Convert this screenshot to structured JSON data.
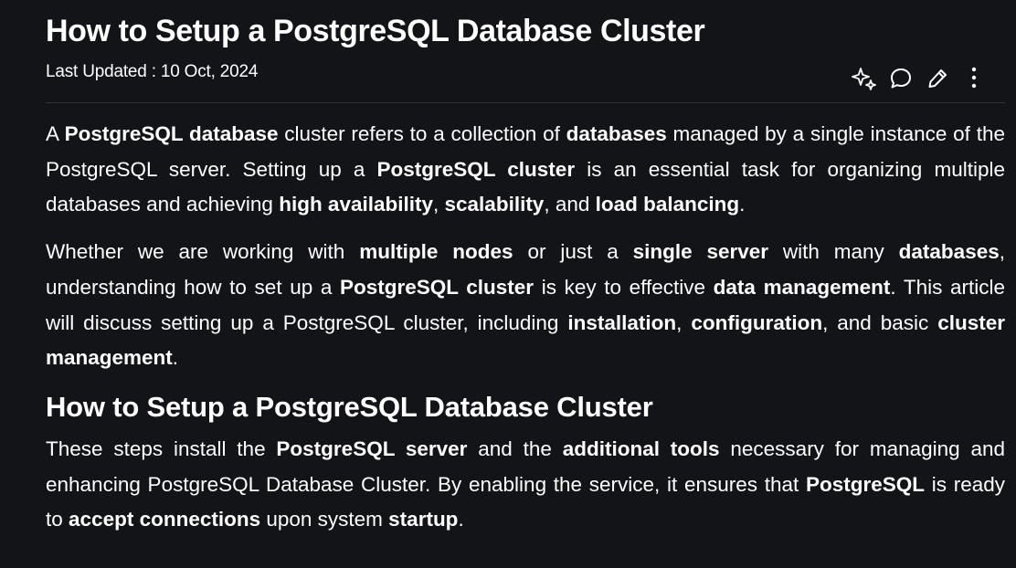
{
  "article": {
    "title": "How to Setup a PostgreSQL Database Cluster",
    "last_updated": "Last Updated : 10 Oct, 2024"
  },
  "actions": {
    "ai_icon": "sparkles-icon",
    "comment_icon": "comment-icon",
    "edit_icon": "pencil-icon",
    "more_icon": "more-vertical-icon"
  },
  "paragraphs": {
    "p1": [
      {
        "t": "A "
      },
      {
        "t": "PostgreSQL database",
        "b": true
      },
      {
        "t": " cluster refers to a collection of "
      },
      {
        "t": "databases",
        "b": true
      },
      {
        "t": " managed by a single instance of the PostgreSQL server. Setting up a "
      },
      {
        "t": "PostgreSQL cluster",
        "b": true
      },
      {
        "t": " is an essential task for organizing multiple databases and achieving "
      },
      {
        "t": "high availability",
        "b": true
      },
      {
        "t": ", "
      },
      {
        "t": "scalability",
        "b": true
      },
      {
        "t": ", and "
      },
      {
        "t": "load balancing",
        "b": true
      },
      {
        "t": "."
      }
    ],
    "p2": [
      {
        "t": "Whether we are working with "
      },
      {
        "t": "multiple nodes",
        "b": true
      },
      {
        "t": " or just a "
      },
      {
        "t": "single server",
        "b": true
      },
      {
        "t": " with many "
      },
      {
        "t": "databases",
        "b": true
      },
      {
        "t": ", understanding how to set up a "
      },
      {
        "t": "PostgreSQL cluster",
        "b": true
      },
      {
        "t": " is key to effective "
      },
      {
        "t": "data management",
        "b": true
      },
      {
        "t": ". This article will discuss setting up a PostgreSQL cluster, including "
      },
      {
        "t": "installation",
        "b": true
      },
      {
        "t": ", "
      },
      {
        "t": "configuration",
        "b": true
      },
      {
        "t": ", and basic "
      },
      {
        "t": "cluster management",
        "b": true
      },
      {
        "t": "."
      }
    ],
    "p3": [
      {
        "t": "These steps install the "
      },
      {
        "t": "PostgreSQL server",
        "b": true
      },
      {
        "t": " and the "
      },
      {
        "t": "additional tools",
        "b": true
      },
      {
        "t": " necessary for managing and enhancing PostgreSQL Database Cluster. By enabling the service, it ensures that "
      },
      {
        "t": "PostgreSQL",
        "b": true
      },
      {
        "t": " is ready to "
      },
      {
        "t": "accept connections",
        "b": true
      },
      {
        "t": " upon system "
      },
      {
        "t": "startup",
        "b": true
      },
      {
        "t": "."
      }
    ]
  },
  "section": {
    "heading": "How to Setup a PostgreSQL Database Cluster"
  },
  "colors": {
    "background": "#131417",
    "text": "#ffffff",
    "divider": "#2e3035"
  }
}
